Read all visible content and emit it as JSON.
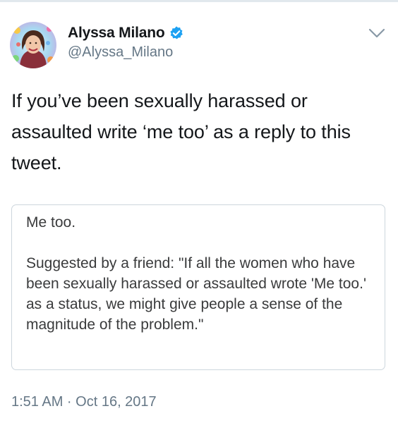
{
  "tweet": {
    "author": {
      "display_name": "Alyssa Milano",
      "handle": "@Alyssa_Milano",
      "verified": true
    },
    "text": "If you’ve been sexually harassed or assaulted write ‘me too’ as a reply to this tweet.",
    "attached_text": {
      "first_line": "Me too.",
      "body": "Suggested by a friend: \"If all the women who have been sexually harassed or assaulted wrote 'Me too.' as a status, we might give people a sense of the magnitude of the problem.\""
    },
    "timestamp": "1:51 AM · Oct 16, 2017"
  },
  "icons": {
    "verified": "verified-badge-icon",
    "menu": "chevron-down-icon"
  },
  "colors": {
    "verified_blue": "#1da1f2",
    "secondary_text": "#657786",
    "card_border": "#ccd6dd"
  }
}
